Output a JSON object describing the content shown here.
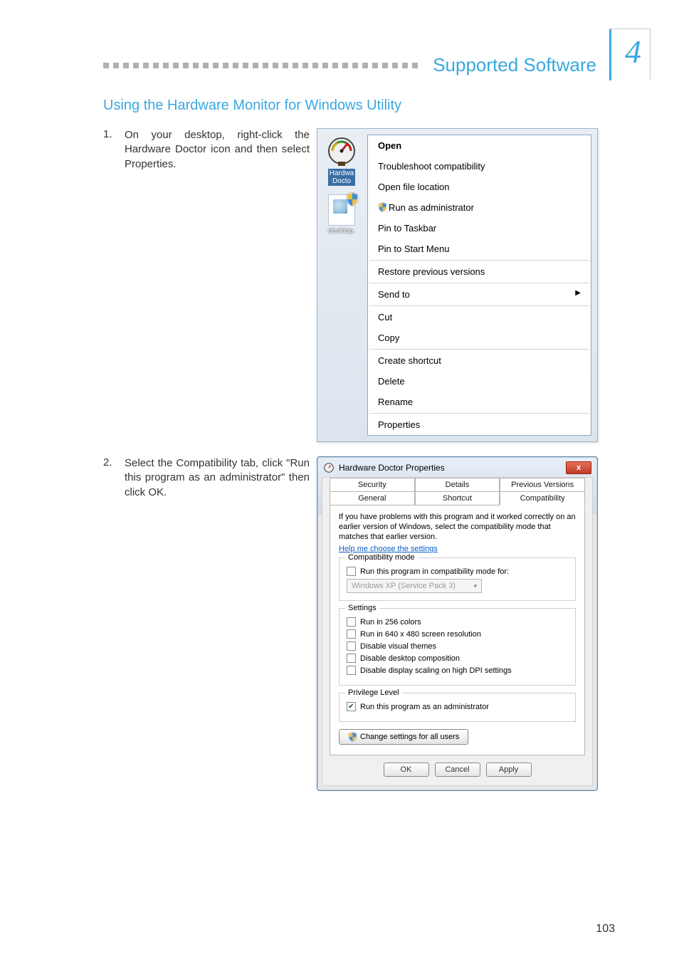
{
  "header": {
    "chapter_number": "4",
    "title": "Supported Software"
  },
  "section_title": "Using the Hardware Monitor for Windows Utility",
  "step1": {
    "num": "1.",
    "text": "On your desktop, right-click the Hardware Doctor icon and then select Properties.",
    "icon_labels": {
      "hardware_doctor": "Hardwa\nDocto",
      "desktop_ini": "desktop."
    },
    "context_menu": {
      "open": "Open",
      "troubleshoot": "Troubleshoot compatibility",
      "open_file_location": "Open file location",
      "run_as_admin": "Run as administrator",
      "pin_taskbar": "Pin to Taskbar",
      "pin_start": "Pin to Start Menu",
      "restore": "Restore previous versions",
      "send_to": "Send to",
      "cut": "Cut",
      "copy": "Copy",
      "create_shortcut": "Create shortcut",
      "delete": "Delete",
      "rename": "Rename",
      "properties": "Properties"
    }
  },
  "step2": {
    "num": "2.",
    "text": "Select the Compatibility tab, click \"Run this program as an administrator\" then click OK.",
    "dialog": {
      "title": "Hardware Doctor Properties",
      "tabs": {
        "security": "Security",
        "details": "Details",
        "previous_versions": "Previous Versions",
        "general": "General",
        "shortcut": "Shortcut",
        "compatibility": "Compatibility"
      },
      "desc": "If you have problems with this program and it worked correctly on an earlier version of Windows, select the compatibility mode that matches that earlier version.",
      "help_link": "Help me choose the settings",
      "groups": {
        "compat_mode": "Compatibility mode",
        "settings": "Settings",
        "privilege": "Privilege Level"
      },
      "compat_mode": {
        "label": "Run this program in compatibility mode for:",
        "combo": "Windows XP (Service Pack 3)"
      },
      "settings": {
        "colors": "Run in 256 colors",
        "res": "Run in 640 x 480 screen resolution",
        "themes": "Disable visual themes",
        "composition": "Disable desktop composition",
        "dpi": "Disable display scaling on high DPI settings"
      },
      "privilege": {
        "admin": "Run this program as an administrator"
      },
      "change_all": "Change settings for all users",
      "buttons": {
        "ok": "OK",
        "cancel": "Cancel",
        "apply": "Apply"
      }
    }
  },
  "page_number": "103"
}
